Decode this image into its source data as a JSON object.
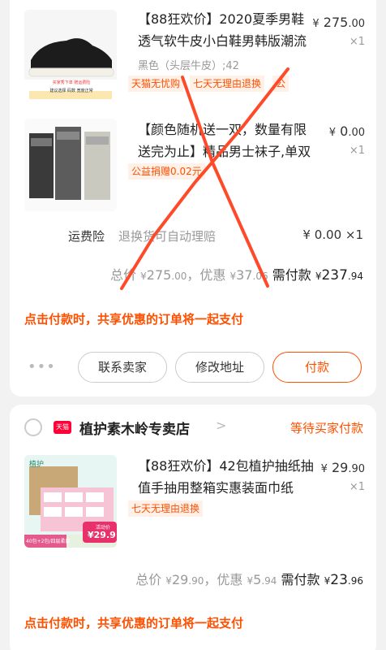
{
  "order1": {
    "item1": {
      "title": "【88狂欢价】2020夏季男鞋透气软牛皮小白鞋男韩版潮流百搭",
      "price_symbol": "¥",
      "price_int": "275",
      "price_dec": ".00",
      "qty": "×1",
      "spec": "黑色（头层牛皮）;42",
      "tags": [
        "天猫无忧购",
        "七天无理由退换",
        "公"
      ],
      "thumb_text": [
        "买家秀下单 赠运费险",
        "建议选择 码数",
        "宽度正常"
      ]
    },
    "item2": {
      "title": "【颜色随机送一双，数量有限送完为止】精品男士袜子,单双装",
      "price_symbol": "¥",
      "price_int": "0",
      "price_dec": ".00",
      "qty": "×1",
      "tag": "公益捐赠0.02元"
    },
    "shipping": {
      "label": "运费险",
      "desc": "退换货可自动理赔",
      "price": "¥ 0.00 ×1"
    },
    "total": {
      "total_label": "总价",
      "total_sym": "¥",
      "total_int": "275",
      "total_dec": ".00",
      "discount_label": "，优惠",
      "discount_sym": "¥",
      "discount_int": "37",
      "discount_dec": ".06",
      "pay_label": "需付款",
      "pay_sym": "¥",
      "pay_int": "237",
      "pay_dec": ".94"
    },
    "note": "点击付款时，共享优惠的订单将一起支付",
    "actions": {
      "more": "•••",
      "contact": "联系卖家",
      "address": "修改地址",
      "pay": "付款"
    }
  },
  "order2": {
    "shop_badge": "天猫",
    "shop_name": "植护素木岭专卖店",
    "chevron": ">",
    "status": "等待买家付款",
    "item": {
      "title": "【88狂欢价】42包植护抽纸抽值手抽用整箱实惠装面巾纸",
      "price_symbol": "¥",
      "price_int": "29",
      "price_dec": ".90",
      "qty": "×1",
      "tag": "七天无理由退换",
      "thumb_brand": "植护",
      "thumb_badge_small": "活动价",
      "thumb_price": "29.9",
      "thumb_strip": "40包+2包/四层柔厚"
    },
    "total": {
      "total_label": "总价",
      "total_sym": "¥",
      "total_int": "29",
      "total_dec": ".90",
      "discount_label": "，优惠",
      "discount_sym": "¥",
      "discount_int": "5",
      "discount_dec": ".94",
      "pay_label": "需付款",
      "pay_sym": "¥",
      "pay_int": "23",
      "pay_dec": ".96"
    },
    "note": "点击付款时，共享优惠的订单将一起支付"
  },
  "colors": {
    "accent": "#ff5000",
    "overlay_red": "#ff4a2a",
    "tmall_red": "#ff0036"
  }
}
